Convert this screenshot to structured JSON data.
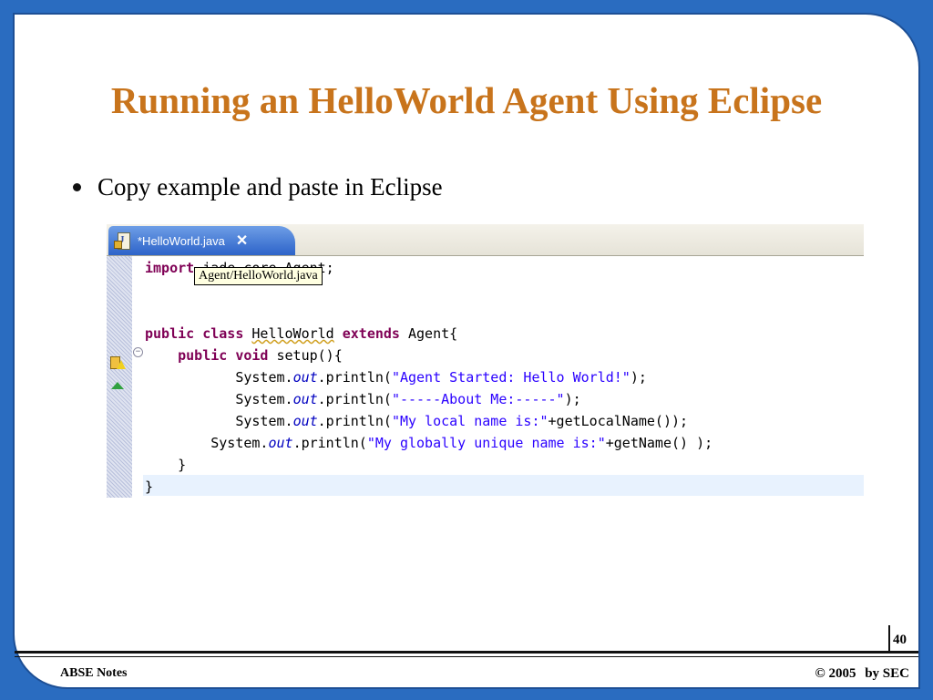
{
  "slide": {
    "title": "Running an HelloWorld Agent Using Eclipse",
    "bullet": "Copy example and paste in Eclipse",
    "page_number": "40",
    "footer_left": "ABSE Notes",
    "footer_copyright": "©",
    "footer_year": "2005",
    "footer_by": "by SEC"
  },
  "editor": {
    "tab_label": "*HelloWorld.java",
    "close_glyph": "✕",
    "tooltip": "Agent/HelloWorld.java",
    "code": {
      "l1_kw": "import",
      "l1_rest": " jade.core.Agent;",
      "l3_kw1": "public",
      "l3_kw2": "class",
      "l3_name": "HelloWorld",
      "l3_kw3": "extends",
      "l3_rest": " Agent{",
      "l4_kw1": "public",
      "l4_kw2": "void",
      "l4_rest": " setup(){",
      "l5_pre": "System.",
      "l5_out": "out",
      "l5_mid": ".println(",
      "l5_str": "\"Agent Started: Hello World!\"",
      "l5_end": ");",
      "l6_pre": "System.",
      "l6_out": "out",
      "l6_mid": ".println(",
      "l6_str": "\"-----About Me:-----\"",
      "l6_end": ");",
      "l7_pre": "System.",
      "l7_out": "out",
      "l7_mid": ".println(",
      "l7_str": "\"My local name is:\"",
      "l7_end": "+getLocalName());",
      "l8_pre": "System.",
      "l8_out": "out",
      "l8_mid": ".println(",
      "l8_str": "\"My globally unique name is:\"",
      "l8_end": "+getName() );",
      "l9": "}",
      "l10": "}"
    }
  },
  "colors": {
    "frame": "#2a6cc0",
    "title": "#c8741c",
    "keyword": "#7f0055",
    "string": "#2a00ff",
    "field": "#0000c0"
  }
}
